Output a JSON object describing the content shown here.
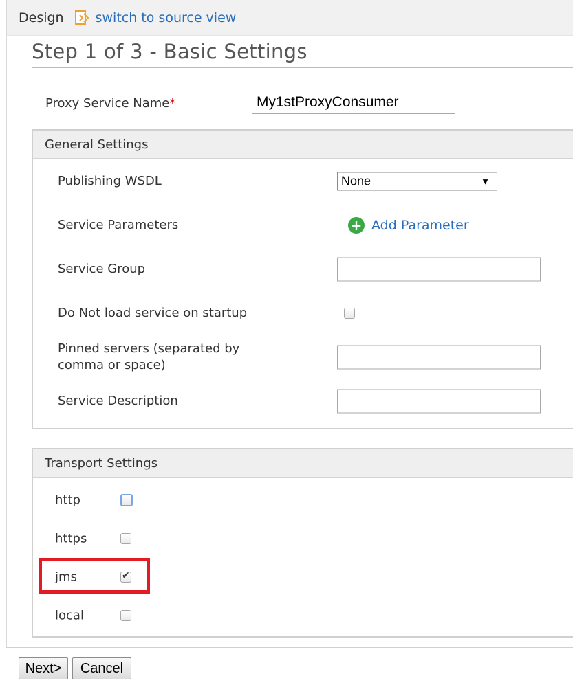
{
  "topbar": {
    "design_label": "Design",
    "source_link": "switch to source view"
  },
  "title": "Step 1 of 3 - Basic Settings",
  "proxy": {
    "label": "Proxy Service Name",
    "required_mark": "*",
    "value": "My1stProxyConsumer"
  },
  "general": {
    "header": "General Settings",
    "publishing_wsdl": {
      "label": "Publishing WSDL",
      "selected": "None"
    },
    "service_parameters": {
      "label": "Service Parameters",
      "add_label": "Add Parameter"
    },
    "service_group": {
      "label": "Service Group",
      "value": ""
    },
    "do_not_load": {
      "label": "Do Not load service on startup",
      "checked": false
    },
    "pinned_servers": {
      "label_line1": "Pinned servers (separated by",
      "label_line2": "comma or space)",
      "value": ""
    },
    "service_description": {
      "label": "Service Description",
      "value": ""
    }
  },
  "transport": {
    "header": "Transport Settings",
    "items": [
      {
        "label": "http",
        "checked": false
      },
      {
        "label": "https",
        "checked": false
      },
      {
        "label": "jms",
        "checked": true
      },
      {
        "label": "local",
        "checked": false
      }
    ]
  },
  "buttons": {
    "next": "Next>",
    "cancel": "Cancel"
  },
  "colors": {
    "link": "#2a6ebb",
    "required": "#cc0000",
    "highlight": "#e31b23",
    "add_icon": "#3aa845"
  }
}
